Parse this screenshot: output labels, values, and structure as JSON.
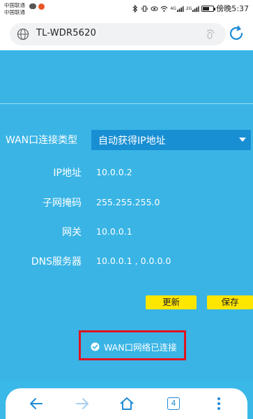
{
  "status_bar": {
    "carrier_1": "中国联通",
    "carrier_2": "中国联通",
    "time": "傍晚5:37",
    "signal_1": "4G",
    "signal_2": "2G"
  },
  "browser": {
    "url": "TL-WDR5620",
    "tab_count": "4"
  },
  "form": {
    "wan_type_label": "WAN口连接类型",
    "wan_type_value": "自动获得IP地址",
    "rows": [
      {
        "label": "IP地址",
        "value": "10.0.0.2"
      },
      {
        "label": "子网掩码",
        "value": "255.255.255.0"
      },
      {
        "label": "网关",
        "value": "10.0.0.1"
      },
      {
        "label": "DNS服务器",
        "value": "10.0.0.1 , 0.0.0.0"
      }
    ],
    "update_button": "更新",
    "save_button": "保存",
    "status_message": "WAN口网络已连接"
  },
  "colors": {
    "page_bg": "#39b4e5",
    "select_bg": "#188fd3",
    "button_bg": "#ffe600",
    "highlight_border": "#e0141e",
    "browser_accent": "#1e8bd6"
  }
}
